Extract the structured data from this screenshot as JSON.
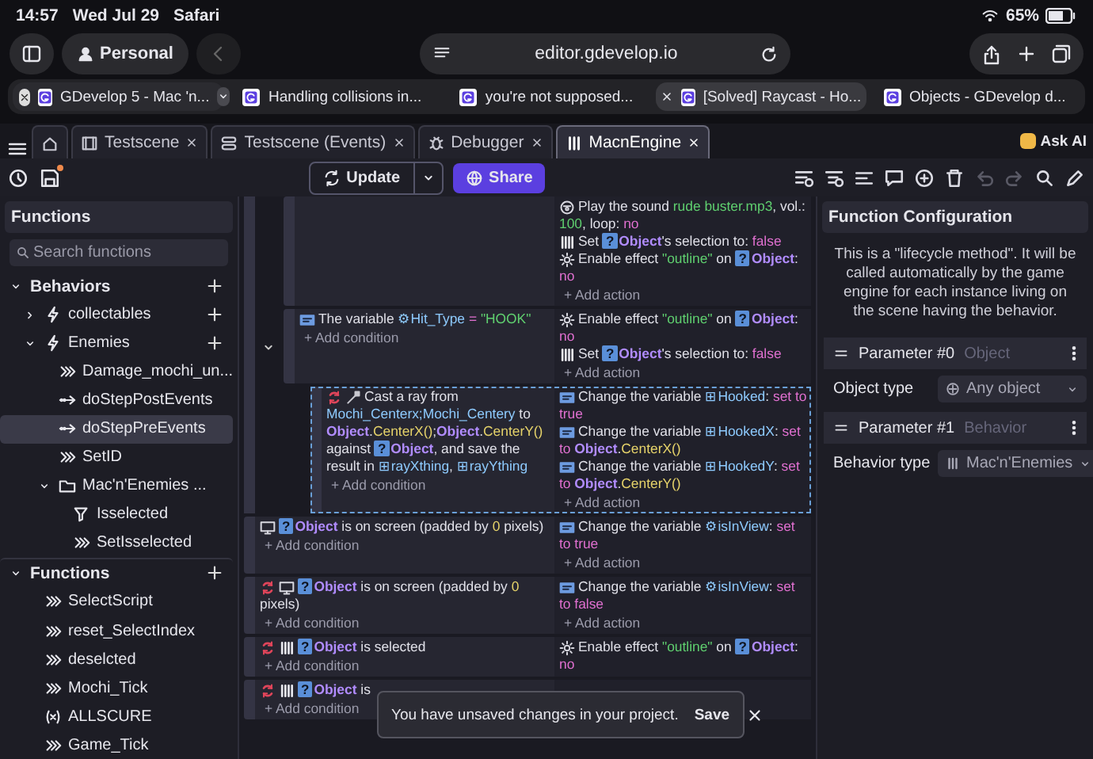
{
  "status_bar": {
    "time": "14:57",
    "date": "Wed Jul 29",
    "app": "Safari",
    "battery": "65%"
  },
  "safari": {
    "profile": "Personal",
    "url": "editor.gdevelop.io",
    "back_disabled": true
  },
  "browser_tabs": [
    {
      "title": "GDevelop 5 - Mac 'n...",
      "selected": false,
      "has_menu": true
    },
    {
      "title": "Handling collisions in...",
      "selected": false,
      "has_menu": false
    },
    {
      "title": "you're not supposed...",
      "selected": false,
      "has_menu": false
    },
    {
      "title": "[Solved] Raycast - Ho...",
      "selected": true,
      "has_menu": false
    },
    {
      "title": "Objects - GDevelop d...",
      "selected": false,
      "has_menu": false
    }
  ],
  "editor_tabs": [
    {
      "kind": "home",
      "selected": false
    },
    {
      "kind": "scene",
      "label": "Testscene",
      "selected": false
    },
    {
      "kind": "events",
      "label": "Testscene (Events)",
      "selected": false
    },
    {
      "kind": "debugger",
      "label": "Debugger",
      "selected": false
    },
    {
      "kind": "behavior",
      "label": "MacnEngine",
      "selected": true
    }
  ],
  "ask_ai": "Ask AI",
  "toolbar": {
    "unsaved": true,
    "update": "Update",
    "share": "Share",
    "tools": [
      {
        "kind": "add-event",
        "disabled": false
      },
      {
        "kind": "add-sub-event",
        "disabled": false
      },
      {
        "kind": "add-else",
        "disabled": false
      },
      {
        "kind": "add-comment",
        "disabled": false
      },
      {
        "kind": "add-other",
        "disabled": false
      },
      {
        "kind": "delete",
        "disabled": false
      },
      {
        "kind": "undo",
        "disabled": true
      },
      {
        "kind": "redo",
        "disabled": true
      },
      {
        "kind": "search",
        "disabled": false
      },
      {
        "kind": "edit",
        "disabled": false
      }
    ]
  },
  "functions_panel": {
    "title": "Functions",
    "search_placeholder": "Search functions",
    "tree": [
      {
        "kind": "section",
        "label": "Behaviors",
        "expanded": true,
        "add_button": true,
        "selected": false,
        "children": [
          {
            "kind": "behavior",
            "label": "collectables",
            "expanded": false,
            "add_button": true,
            "selected": false
          },
          {
            "kind": "behavior",
            "label": "Enemies",
            "expanded": true,
            "add_button": true,
            "selected": false,
            "children": [
              {
                "kind": "action",
                "label": "Damage_mochi_un...",
                "selected": false
              },
              {
                "kind": "lifecycle",
                "label": "doStepPostEvents",
                "selected": false
              },
              {
                "kind": "lifecycle",
                "label": "doStepPreEvents",
                "selected": true
              },
              {
                "kind": "action",
                "label": "SetID",
                "selected": false
              },
              {
                "kind": "folder",
                "label": "Mac'n'Enemies ...",
                "expanded": true,
                "selected": false,
                "children": [
                  {
                    "kind": "condition",
                    "label": "Isselected",
                    "selected": false
                  },
                  {
                    "kind": "action",
                    "label": "SetIsselected",
                    "selected": false
                  }
                ]
              }
            ]
          }
        ]
      },
      {
        "kind": "section",
        "label": "Functions",
        "expanded": true,
        "add_button": true,
        "selected": false,
        "children": [
          {
            "kind": "action",
            "label": "SelectScript",
            "selected": false
          },
          {
            "kind": "action",
            "label": "reset_SelectIndex",
            "selected": false
          },
          {
            "kind": "action",
            "label": "deselcted",
            "selected": false
          },
          {
            "kind": "action",
            "label": "Mochi_Tick",
            "selected": false
          },
          {
            "kind": "expression",
            "label": "ALLSCURE",
            "selected": false
          },
          {
            "kind": "action",
            "label": "Game_Tick",
            "selected": false
          }
        ]
      }
    ]
  },
  "events": [
    {
      "selected": false,
      "children": [
        {
          "selected": false,
          "actions": [
            {
              "kind": "sound",
              "inverted": false,
              "parts": [
                {
                  "kind": "plain",
                  "text": "Play the sound "
                },
                {
                  "kind": "str",
                  "text": "rude buster.mp3"
                },
                {
                  "kind": "plain",
                  "text": ", vol.: "
                },
                {
                  "kind": "str",
                  "text": "100"
                },
                {
                  "kind": "plain",
                  "text": ", loop: "
                },
                {
                  "kind": "bool",
                  "text": "no"
                }
              ]
            },
            {
              "kind": "behavior",
              "inverted": false,
              "parts": [
                {
                  "kind": "plain",
                  "text": "Set "
                },
                {
                  "kind": "objicon",
                  "text": "?"
                },
                {
                  "kind": "object",
                  "text": "Object"
                },
                {
                  "kind": "plain",
                  "text": "'s selection to: "
                },
                {
                  "kind": "bool",
                  "text": "false"
                }
              ]
            },
            {
              "kind": "effect",
              "inverted": false,
              "parts": [
                {
                  "kind": "plain",
                  "text": "Enable effect "
                },
                {
                  "kind": "str",
                  "text": "\"outline\""
                },
                {
                  "kind": "plain",
                  "text": " on "
                },
                {
                  "kind": "objicon",
                  "text": "?"
                },
                {
                  "kind": "object",
                  "text": "Object"
                },
                {
                  "kind": "plain",
                  "text": ": "
                },
                {
                  "kind": "bool",
                  "text": "no"
                }
              ]
            }
          ],
          "add_action": "+ Add action"
        },
        {
          "selected": false,
          "expanded": true,
          "conditions": [
            {
              "kind": "variable",
              "inverted": false,
              "parts": [
                {
                  "kind": "plain",
                  "text": "The variable "
                },
                {
                  "kind": "glyph",
                  "text": "⚙"
                },
                {
                  "kind": "var",
                  "text": "Hit_Type"
                },
                {
                  "kind": "op",
                  "text": " = "
                },
                {
                  "kind": "str",
                  "text": "\"HOOK\""
                }
              ]
            }
          ],
          "add_condition": "+ Add condition",
          "actions": [
            {
              "kind": "effect",
              "inverted": false,
              "parts": [
                {
                  "kind": "plain",
                  "text": "Enable effect "
                },
                {
                  "kind": "str",
                  "text": "\"outline\""
                },
                {
                  "kind": "plain",
                  "text": " on "
                },
                {
                  "kind": "objicon",
                  "text": "?"
                },
                {
                  "kind": "object",
                  "text": "Object"
                },
                {
                  "kind": "plain",
                  "text": ": "
                },
                {
                  "kind": "bool",
                  "text": "no"
                }
              ]
            },
            {
              "kind": "behavior",
              "inverted": false,
              "parts": [
                {
                  "kind": "plain",
                  "text": "Set "
                },
                {
                  "kind": "objicon",
                  "text": "?"
                },
                {
                  "kind": "object",
                  "text": "Object"
                },
                {
                  "kind": "plain",
                  "text": "'s selection to: "
                },
                {
                  "kind": "bool",
                  "text": "false"
                }
              ]
            }
          ],
          "add_action": "+ Add action",
          "children": [
            {
              "selected": true,
              "conditions": [
                {
                  "kind": "raycast",
                  "inverted": true,
                  "parts": [
                    {
                      "kind": "plain",
                      "text": "Cast a ray from "
                    },
                    {
                      "kind": "var",
                      "text": "Mochi_Centerx;Mochi_Centery"
                    },
                    {
                      "kind": "plain",
                      "text": " to "
                    },
                    {
                      "kind": "object",
                      "text": "Object"
                    },
                    {
                      "kind": "plain",
                      "text": "."
                    },
                    {
                      "kind": "func",
                      "text": "CenterX()"
                    },
                    {
                      "kind": "plain",
                      "text": ";"
                    },
                    {
                      "kind": "object",
                      "text": "Object"
                    },
                    {
                      "kind": "plain",
                      "text": "."
                    },
                    {
                      "kind": "func",
                      "text": "CenterY()"
                    },
                    {
                      "kind": "plain",
                      "text": " against "
                    },
                    {
                      "kind": "objicon",
                      "text": "?"
                    },
                    {
                      "kind": "object",
                      "text": "Object"
                    },
                    {
                      "kind": "plain",
                      "text": ", and save the result in "
                    },
                    {
                      "kind": "glyph",
                      "text": "⊞"
                    },
                    {
                      "kind": "var",
                      "text": "rayXthing"
                    },
                    {
                      "kind": "plain",
                      "text": ", "
                    },
                    {
                      "kind": "glyph",
                      "text": "⊞"
                    },
                    {
                      "kind": "var",
                      "text": "rayYthing"
                    }
                  ]
                }
              ],
              "add_condition": "+ Add condition",
              "actions": [
                {
                  "kind": "variable",
                  "inverted": false,
                  "parts": [
                    {
                      "kind": "plain",
                      "text": "Change the variable "
                    },
                    {
                      "kind": "glyph",
                      "text": "⊞"
                    },
                    {
                      "kind": "var",
                      "text": "Hooked"
                    },
                    {
                      "kind": "plain",
                      "text": ": "
                    },
                    {
                      "kind": "bool",
                      "text": "set to true"
                    }
                  ]
                },
                {
                  "kind": "variable",
                  "inverted": false,
                  "parts": [
                    {
                      "kind": "plain",
                      "text": "Change the variable "
                    },
                    {
                      "kind": "glyph",
                      "text": "⊞"
                    },
                    {
                      "kind": "var",
                      "text": "HookedX"
                    },
                    {
                      "kind": "plain",
                      "text": ": "
                    },
                    {
                      "kind": "bool",
                      "text": "set to "
                    },
                    {
                      "kind": "object",
                      "text": "Object"
                    },
                    {
                      "kind": "plain",
                      "text": "."
                    },
                    {
                      "kind": "func",
                      "text": "CenterX()"
                    }
                  ]
                },
                {
                  "kind": "variable",
                  "inverted": false,
                  "parts": [
                    {
                      "kind": "plain",
                      "text": "Change the variable "
                    },
                    {
                      "kind": "glyph",
                      "text": "⊞"
                    },
                    {
                      "kind": "var",
                      "text": "HookedY"
                    },
                    {
                      "kind": "plain",
                      "text": ": "
                    },
                    {
                      "kind": "bool",
                      "text": "set to "
                    },
                    {
                      "kind": "object",
                      "text": "Object"
                    },
                    {
                      "kind": "plain",
                      "text": "."
                    },
                    {
                      "kind": "func",
                      "text": "CenterY()"
                    }
                  ]
                }
              ],
              "add_action": "+ Add action"
            }
          ]
        }
      ]
    },
    {
      "selected": false,
      "conditions": [
        {
          "kind": "screen",
          "inverted": false,
          "parts": [
            {
              "kind": "objicon",
              "text": "?"
            },
            {
              "kind": "object",
              "text": "Object"
            },
            {
              "kind": "plain",
              "text": " is on screen (padded by "
            },
            {
              "kind": "number",
              "text": "0"
            },
            {
              "kind": "plain",
              "text": " pixels)"
            }
          ]
        }
      ],
      "add_condition": "+ Add condition",
      "actions": [
        {
          "kind": "variable",
          "inverted": false,
          "parts": [
            {
              "kind": "plain",
              "text": "Change the variable "
            },
            {
              "kind": "glyph",
              "text": "⚙"
            },
            {
              "kind": "var",
              "text": "isInView"
            },
            {
              "kind": "plain",
              "text": ": "
            },
            {
              "kind": "bool",
              "text": "set to true"
            }
          ]
        }
      ],
      "add_action": "+ Add action"
    },
    {
      "selected": false,
      "conditions": [
        {
          "kind": "screen",
          "inverted": true,
          "parts": [
            {
              "kind": "objicon",
              "text": "?"
            },
            {
              "kind": "object",
              "text": "Object"
            },
            {
              "kind": "plain",
              "text": " is on screen (padded by "
            },
            {
              "kind": "number",
              "text": "0"
            },
            {
              "kind": "plain",
              "text": " pixels)"
            }
          ]
        }
      ],
      "add_condition": "+ Add condition",
      "actions": [
        {
          "kind": "variable",
          "inverted": false,
          "parts": [
            {
              "kind": "plain",
              "text": "Change the variable "
            },
            {
              "kind": "glyph",
              "text": "⚙"
            },
            {
              "kind": "var",
              "text": "isInView"
            },
            {
              "kind": "plain",
              "text": ": "
            },
            {
              "kind": "bool",
              "text": "set to false"
            }
          ]
        }
      ],
      "add_action": "+ Add action"
    },
    {
      "selected": false,
      "conditions": [
        {
          "kind": "behavior",
          "inverted": true,
          "parts": [
            {
              "kind": "objicon",
              "text": "?"
            },
            {
              "kind": "object",
              "text": "Object"
            },
            {
              "kind": "plain",
              "text": " is selected"
            }
          ]
        }
      ],
      "add_condition": "+ Add condition",
      "actions": [
        {
          "kind": "effect",
          "inverted": false,
          "parts": [
            {
              "kind": "plain",
              "text": "Enable effect "
            },
            {
              "kind": "str",
              "text": "\"outline\""
            },
            {
              "kind": "plain",
              "text": " on "
            },
            {
              "kind": "objicon",
              "text": "?"
            },
            {
              "kind": "object",
              "text": "Object"
            },
            {
              "kind": "plain",
              "text": ": "
            },
            {
              "kind": "bool",
              "text": "no"
            }
          ]
        }
      ]
    },
    {
      "selected": false,
      "conditions": [
        {
          "kind": "behavior",
          "inverted": true,
          "parts": [
            {
              "kind": "objicon",
              "text": "?"
            },
            {
              "kind": "object",
              "text": "Object"
            },
            {
              "kind": "plain",
              "text": " is"
            }
          ]
        }
      ],
      "add_condition": "+ Add condition"
    }
  ],
  "config_panel": {
    "title": "Function Configuration",
    "description": "This is a \"lifecycle method\". It will be called automatically by the game engine for each instance living on the scene having the behavior.",
    "parameters": [
      {
        "name": "Parameter #0",
        "type": "Object",
        "field_label": "Object type",
        "kind": "object",
        "field_value": "Any object"
      },
      {
        "name": "Parameter #1",
        "type": "Behavior",
        "field_label": "Behavior type",
        "kind": "behavior",
        "field_value": "Mac'n'Enemies"
      }
    ]
  },
  "toast": {
    "message": "You have unsaved changes in your project.",
    "action": "Save"
  }
}
